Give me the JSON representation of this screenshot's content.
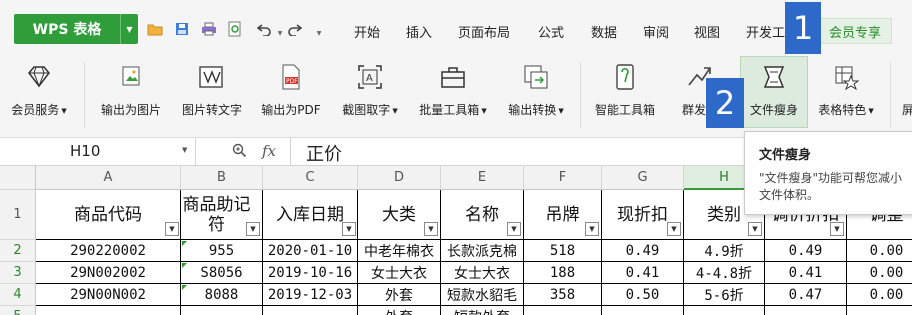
{
  "app": {
    "title": "WPS 表格",
    "quick_access": [
      "open-folder-icon",
      "save-icon",
      "print-icon",
      "print-preview-icon",
      "undo-icon",
      "redo-icon",
      "more-icon"
    ]
  },
  "menu": {
    "tabs": [
      "开始",
      "插入",
      "页面布局",
      "公式",
      "数据",
      "审阅",
      "视图",
      "开发工"
    ],
    "active_tab": "会员专享"
  },
  "badges": {
    "one": "1",
    "two": "2"
  },
  "ribbon": {
    "tools": [
      {
        "label": "会员服务",
        "icon": "diamond-icon",
        "dropdown": true
      },
      {
        "label": "输出为图片",
        "icon": "image-export-icon",
        "dropdown": false
      },
      {
        "label": "图片转文字",
        "icon": "image-to-text-icon",
        "dropdown": false
      },
      {
        "label": "输出为PDF",
        "icon": "pdf-export-icon",
        "dropdown": false
      },
      {
        "label": "截图取字",
        "icon": "screenshot-text-icon",
        "dropdown": true
      },
      {
        "label": "批量工具箱",
        "icon": "toolbox-icon",
        "dropdown": true
      },
      {
        "label": "输出转换",
        "icon": "convert-icon",
        "dropdown": true
      },
      {
        "label": "智能工具箱",
        "icon": "smart-toolbox-icon",
        "dropdown": false
      },
      {
        "label": "群发工",
        "icon": "mass-send-icon",
        "dropdown": false
      },
      {
        "label": "文件瘦身",
        "icon": "file-slim-icon",
        "dropdown": false
      },
      {
        "label": "表格特色",
        "icon": "table-feature-icon",
        "dropdown": true
      },
      {
        "label": "屏",
        "icon": "screen-icon",
        "dropdown": false
      }
    ]
  },
  "formula_bar": {
    "cell_ref": "H10",
    "zoom_icon": "zoom-icon",
    "fx": "fx",
    "content": "正价"
  },
  "tooltip": {
    "title": "文件瘦身",
    "description": "\"文件瘦身\"功能可帮您减小文件体积。"
  },
  "sheet": {
    "columns": [
      "A",
      "B",
      "C",
      "D",
      "E",
      "F",
      "G",
      "H",
      "I",
      "J"
    ],
    "selected_column": "H",
    "row_numbers": [
      "1",
      "2",
      "3",
      "4",
      "5"
    ],
    "headers": [
      "商品代码",
      "商品助记符",
      "入库日期",
      "大类",
      "名称",
      "吊牌",
      "现折扣",
      "类别",
      "调价折扣",
      "调整"
    ],
    "rows": [
      [
        "290220002",
        "955",
        "2020-01-10",
        "中老年棉衣",
        "长款派克棉",
        "518",
        "0.49",
        "4.9折",
        "0.49",
        "0.00"
      ],
      [
        "29N002002",
        "S8056",
        "2019-10-16",
        "女士大衣",
        "女士大衣",
        "188",
        "0.41",
        "4-4.8折",
        "0.41",
        "0.00"
      ],
      [
        "29N00N002",
        "8088",
        "2019-12-03",
        "外套",
        "短款水貂毛",
        "358",
        "0.50",
        "5-6折",
        "0.47",
        "0.00"
      ],
      [
        "",
        "",
        "",
        "外套",
        "短款外套",
        "",
        "",
        "",
        "",
        ""
      ]
    ]
  }
}
